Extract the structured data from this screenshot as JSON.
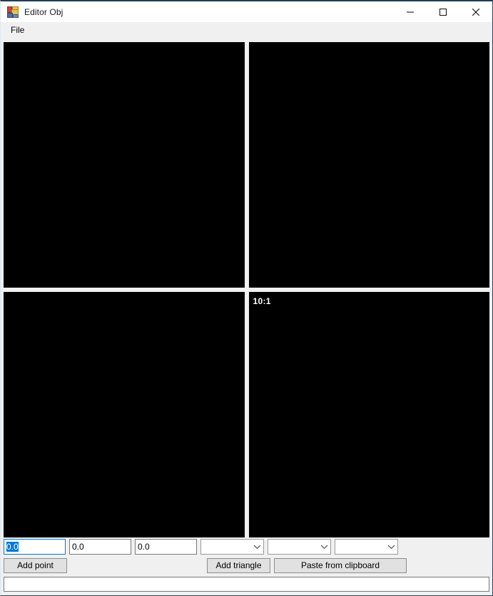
{
  "window": {
    "title": "Editor Obj",
    "icon": "winforms-app-icon",
    "controls": {
      "minimize_label": "minimize-icon",
      "maximize_label": "maximize-icon",
      "close_label": "close-icon"
    }
  },
  "menubar": {
    "items": [
      {
        "label": "File",
        "name": "menu-item-file"
      }
    ]
  },
  "viewports": [
    {
      "name": "viewport-top-left",
      "label": "",
      "background": "#000000"
    },
    {
      "name": "viewport-top-right",
      "label": "",
      "background": "#000000"
    },
    {
      "name": "viewport-bottom-left",
      "label": "",
      "background": "#000000"
    },
    {
      "name": "viewport-bottom-right",
      "label": "10:1",
      "background": "#000000"
    }
  ],
  "controls": {
    "coord_inputs": [
      {
        "name": "coord-x-input",
        "value": "0.0",
        "placeholder": "",
        "focused": true,
        "selected": true
      },
      {
        "name": "coord-y-input",
        "value": "0.0",
        "placeholder": "",
        "focused": false,
        "selected": false
      },
      {
        "name": "coord-z-input",
        "value": "0.0",
        "placeholder": "",
        "focused": false,
        "selected": false
      }
    ],
    "vertex_selects": [
      {
        "name": "triangle-vertex-1-select",
        "value": "",
        "placeholder": ""
      },
      {
        "name": "triangle-vertex-2-select",
        "value": "",
        "placeholder": ""
      },
      {
        "name": "triangle-vertex-3-select",
        "value": "",
        "placeholder": ""
      }
    ],
    "buttons": {
      "add_point": "Add point",
      "add_triangle": "Add triangle",
      "paste_from_clipboard": "Paste from clipboard"
    }
  },
  "logbox": {
    "name": "log-output-input",
    "value": "",
    "placeholder": ""
  },
  "colors": {
    "titlebar_bg": "#ffffff",
    "window_bg": "#f0f0f0",
    "viewport_bg": "#000000",
    "accent_focus": "#0078d7",
    "selection_bg": "#0078d7",
    "button_bg": "#e1e1e1",
    "border": "#7a7a7a",
    "window_border": "#23455f"
  }
}
